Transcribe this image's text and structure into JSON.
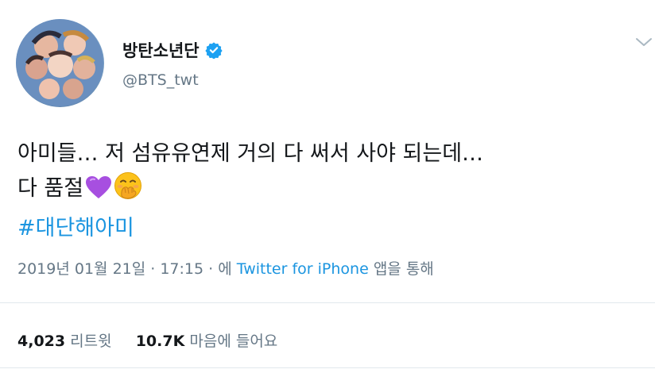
{
  "author": {
    "name": "방탄소년단",
    "handle": "@BTS_twt",
    "avatar_icon": "profile-photo",
    "verified_icon": "verified-badge-icon",
    "verified_color": "#1da1f2"
  },
  "tweet": {
    "line1": "아미들… 저 섬유유연제 거의 다 써서 사야 되는데…",
    "line2": "다 품절",
    "emoji1": "purple-heart",
    "emoji2": "face-with-hand-over-mouth",
    "hashtag": "#대단해아미"
  },
  "meta": {
    "date": "2019년 01월 21일 · 17:15 · 에",
    "source": "Twitter for iPhone",
    "via": "앱을 통해"
  },
  "stats": {
    "retweets": "4,023",
    "retweets_label": "리트윗",
    "likes": "10.7K",
    "likes_label": "마음에 들어요"
  },
  "menu_icon": "chevron-down-icon",
  "colors": {
    "link": "#1b95e0",
    "secondary": "#657786",
    "text": "#14171a"
  }
}
